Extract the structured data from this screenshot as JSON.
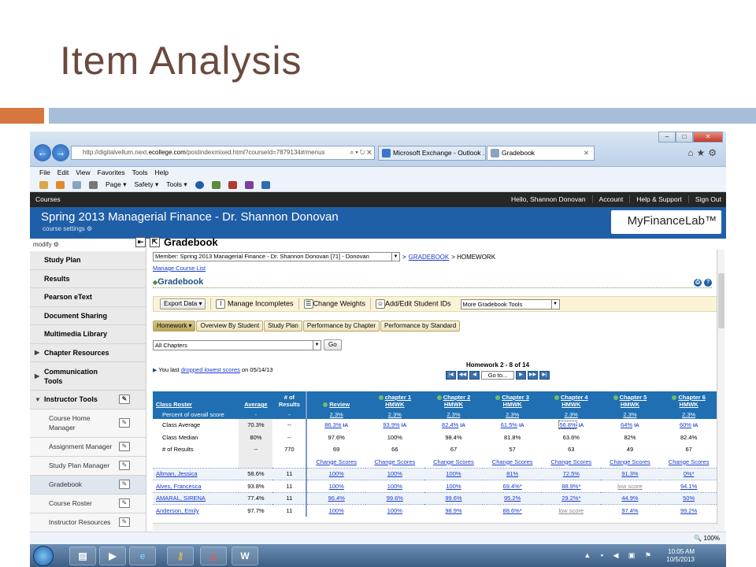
{
  "slide": {
    "title": "Item Analysis"
  },
  "browser": {
    "url_prefix": "http://digitalvellum.next.",
    "url_host": "ecollege.com",
    "url_rest": "/postindexmixed.html?courseId=7879134#/menus",
    "url_controls": "⌕ ▾ ↻ ✕",
    "tab1": "Microsoft Exchange - Outlook ...",
    "tab2": "Gradebook",
    "tab2_close": "✕",
    "menu": [
      "File",
      "Edit",
      "View",
      "Favorites",
      "Tools",
      "Help"
    ],
    "cmd_page": "Page ▾",
    "cmd_safety": "Safety ▾",
    "cmd_tools": "Tools ▾",
    "zoom": "🔍 100%",
    "win_min": "–",
    "win_max": "□",
    "win_close": "✕"
  },
  "site": {
    "courses": "Courses",
    "greeting": "Hello, Shannon Donovan",
    "account": "Account",
    "help": "Help & Support",
    "signout": "Sign Out",
    "course_title": "Spring 2013 Managerial Finance - Dr. Shannon Donovan",
    "course_settings": "course settings ⚙",
    "logo": "MyFinanceLab™"
  },
  "sidebar": {
    "modify": "modify ⚙",
    "items": [
      {
        "label": "Study Plan"
      },
      {
        "label": "Results"
      },
      {
        "label": "Pearson eText"
      },
      {
        "label": "Document Sharing"
      },
      {
        "label": "Multimedia Library"
      },
      {
        "label": "Chapter Resources"
      },
      {
        "label": "Communication Tools"
      },
      {
        "label": "Instructor Tools"
      }
    ],
    "subitems": [
      {
        "label": "Course Home Manager"
      },
      {
        "label": "Assignment Manager"
      },
      {
        "label": "Study Plan Manager"
      },
      {
        "label": "Gradebook"
      },
      {
        "label": "Course Roster"
      },
      {
        "label": "Instructor Resources"
      }
    ]
  },
  "gradebook": {
    "header": "Gradebook",
    "member_select": "Member: Spring 2013 Managerial Finance - Dr. Shannon Donovan [71] - Donovan",
    "breadcrumb_sep": "> ",
    "breadcrumb_link": "GRADEBOOK",
    "breadcrumb_tail": " > HOMEWORK",
    "manage_course_list": "Manage Course List",
    "subtitle": "Gradebook",
    "export": "Export Data ▾",
    "manage_incompletes": "Manage Incompletes",
    "change_weights": "Change Weights",
    "add_edit_ids": "Add/Edit Student IDs",
    "more_tools": "More Gradebook Tools",
    "tabs": [
      "Homework ▾",
      "Overview By Student",
      "Study Plan",
      "Performance by Chapter",
      "Performance by Standard"
    ],
    "chapter_filter": "All Chapters",
    "go": "Go",
    "dropped_prefix": "You last ",
    "dropped_link": "dropped lowest scores",
    "dropped_suffix": " on 05/14/13",
    "hw_range": "Homework 2 - 8 of 14",
    "goto": "Go to..."
  },
  "table": {
    "col_roster": "Class Roster",
    "col_average": "Average",
    "col_results": "# of Results",
    "percent_label": "Percent of overall score",
    "percent_avg": "-",
    "percent_results": "-",
    "assignments": [
      {
        "name1": "Review",
        "name2": "",
        "pct": "2.3%"
      },
      {
        "name1": "chapter 1",
        "name2": "HMWK",
        "pct": "2.3%"
      },
      {
        "name1": "Chapter 2",
        "name2": "HMWK",
        "pct": "2.3%"
      },
      {
        "name1": "Chapter 3",
        "name2": "HMWK",
        "pct": "2.3%"
      },
      {
        "name1": "Chapter 4",
        "name2": "HMWK",
        "pct": "2.3%"
      },
      {
        "name1": "Chapter 5",
        "name2": "HMWK",
        "pct": "2.3%"
      },
      {
        "name1": "Chapter 6",
        "name2": "HMWK",
        "pct": "2.3%"
      }
    ],
    "class_average": {
      "label": "Class Average",
      "avg": "70.3%",
      "results": "--",
      "values": [
        "86.3%",
        "93.9%",
        "82.4%",
        "61.5%",
        "56.8%",
        "64%",
        "60%"
      ],
      "ia": "IA"
    },
    "class_median": {
      "label": "Class Median",
      "avg": "80%",
      "results": "--",
      "values": [
        "97.6%",
        "100%",
        "98.4%",
        "81.8%",
        "63.6%",
        "82%",
        "82.4%"
      ]
    },
    "num_results": {
      "label": "# of Results",
      "avg": "--",
      "results": "770",
      "values": [
        "69",
        "66",
        "67",
        "57",
        "63",
        "49",
        "67"
      ]
    },
    "change_scores": "Change Scores",
    "students": [
      {
        "name": "Altman, Jessica",
        "avg": "58.6%",
        "results": "11",
        "scores": [
          "100%",
          "100%",
          "100%",
          "81%",
          "72.5%",
          "91.3%",
          "0%*"
        ]
      },
      {
        "name": "Alves, Francesca",
        "avg": "93.8%",
        "results": "11",
        "scores": [
          "100%",
          "100%",
          "100%",
          "69.4%*",
          "88.9%*",
          "low score",
          "94.1%"
        ]
      },
      {
        "name": "AMARAL, SIRENA",
        "avg": "77.4%",
        "results": "11",
        "scores": [
          "96.4%",
          "99.6%",
          "99.6%",
          "95.2%",
          "29.2%*",
          "44.9%",
          "50%"
        ]
      },
      {
        "name": "Anderson, Emily",
        "avg": "97.7%",
        "results": "11",
        "scores": [
          "100%",
          "100%",
          "98.9%",
          "88.6%*",
          "low score",
          "97.4%",
          "99.2%"
        ]
      }
    ]
  },
  "status": {
    "clock_time": "10:05 AM",
    "clock_date": "10/5/2013",
    "tray": "▲ ▪ ◀ ▣ ⚑"
  },
  "colors": {
    "title": "#6b4a3e",
    "accent_orange": "#d6773f",
    "accent_blue": "#a7bed8",
    "header_blue": "#1f6fb2",
    "banner_blue": "#1f5fa7"
  }
}
